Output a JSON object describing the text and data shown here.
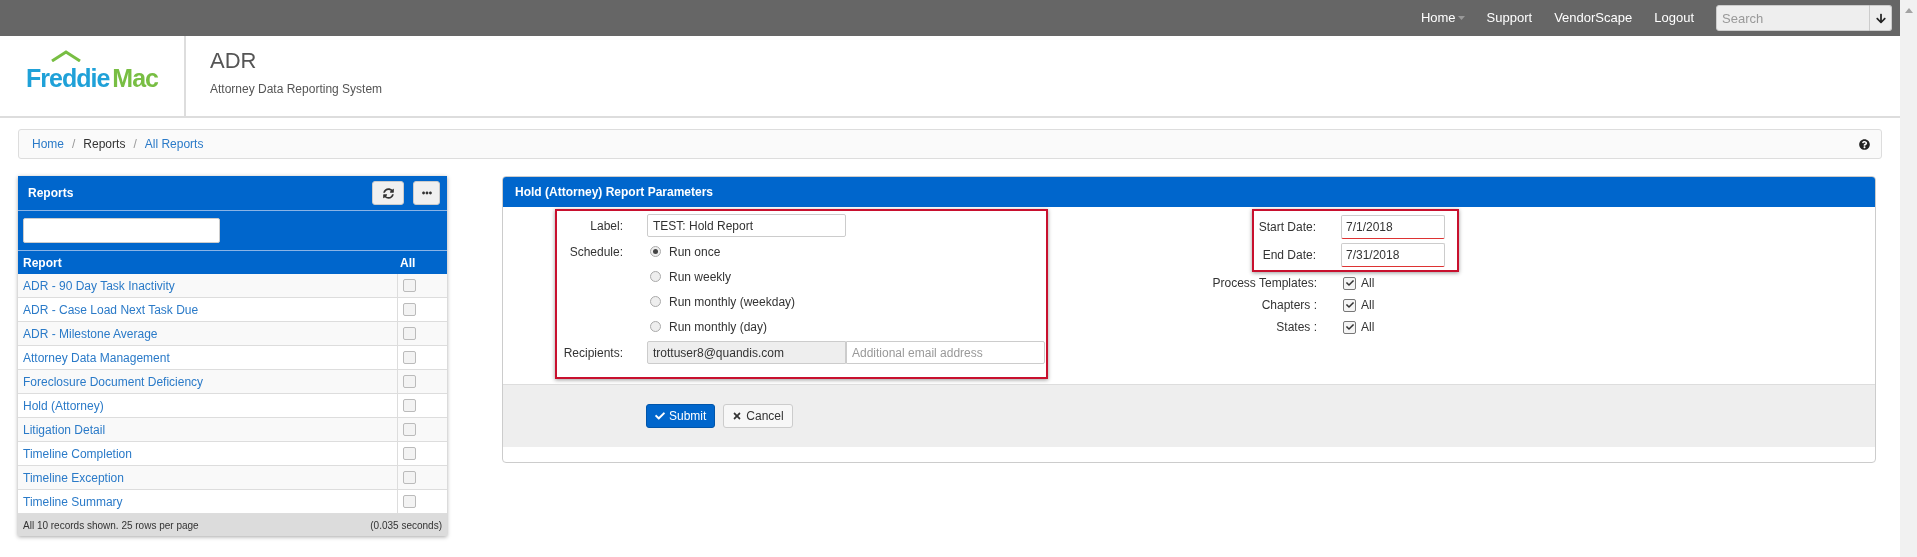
{
  "top_nav": {
    "links": [
      {
        "label": "Home",
        "dropdown": true
      },
      {
        "label": "Support",
        "dropdown": false
      },
      {
        "label": "VendorScape",
        "dropdown": false
      },
      {
        "label": "Logout",
        "dropdown": false
      }
    ],
    "search": {
      "placeholder": "Search"
    }
  },
  "header": {
    "logo": {
      "words": [
        "Freddie",
        "Mac"
      ]
    },
    "title": "ADR",
    "subtitle": "Attorney Data Reporting System"
  },
  "breadcrumb": {
    "separator": "/",
    "items": [
      {
        "label": "Home",
        "link": true
      },
      {
        "label": "Reports",
        "link": false
      },
      {
        "label": "All Reports",
        "link": true
      }
    ]
  },
  "reports_panel": {
    "title": "Reports",
    "columns": [
      "Report",
      "All"
    ],
    "rows": [
      {
        "name": "ADR - 90 Day Task Inactivity",
        "checked": false
      },
      {
        "name": "ADR - Case Load Next Task Due",
        "checked": false
      },
      {
        "name": "ADR - Milestone Average",
        "checked": false
      },
      {
        "name": "Attorney Data Management",
        "checked": false
      },
      {
        "name": "Foreclosure Document Deficiency",
        "checked": false
      },
      {
        "name": "Hold (Attorney)",
        "checked": false
      },
      {
        "name": "Litigation Detail",
        "checked": false
      },
      {
        "name": "Timeline Completion",
        "checked": false
      },
      {
        "name": "Timeline Exception",
        "checked": false
      },
      {
        "name": "Timeline Summary",
        "checked": false
      }
    ],
    "footer_left": "All 10 records shown. 25 rows per page",
    "footer_right": "(0.035 seconds)"
  },
  "parameters_panel": {
    "title": "Hold (Attorney) Report Parameters",
    "main_group": {
      "highlighted": true,
      "label_field": {
        "label": "Label:",
        "value": "TEST: Hold Report"
      },
      "schedule": {
        "label": "Schedule:",
        "options": [
          {
            "label": "Run once",
            "selected": true
          },
          {
            "label": "Run weekly",
            "selected": false
          },
          {
            "label": "Run monthly (weekday)",
            "selected": false
          },
          {
            "label": "Run monthly (day)",
            "selected": false
          }
        ]
      },
      "recipients": {
        "label": "Recipients:",
        "value": "trottuser8@quandis.com",
        "placeholder": "Additional email address"
      }
    },
    "date_group": {
      "highlighted": true,
      "fields": [
        {
          "label": "Start Date:",
          "value": "7/1/2018"
        },
        {
          "label": "End Date:",
          "value": "7/31/2018"
        }
      ]
    },
    "filters": [
      {
        "label": "Process Templates:",
        "option": "All",
        "checked": true
      },
      {
        "label": "Chapters :",
        "option": "All",
        "checked": true
      },
      {
        "label": "States :",
        "option": "All",
        "checked": true
      }
    ],
    "buttons": [
      {
        "kind": "primary",
        "label": "Submit"
      },
      {
        "kind": "secondary",
        "label": "Cancel"
      }
    ]
  }
}
